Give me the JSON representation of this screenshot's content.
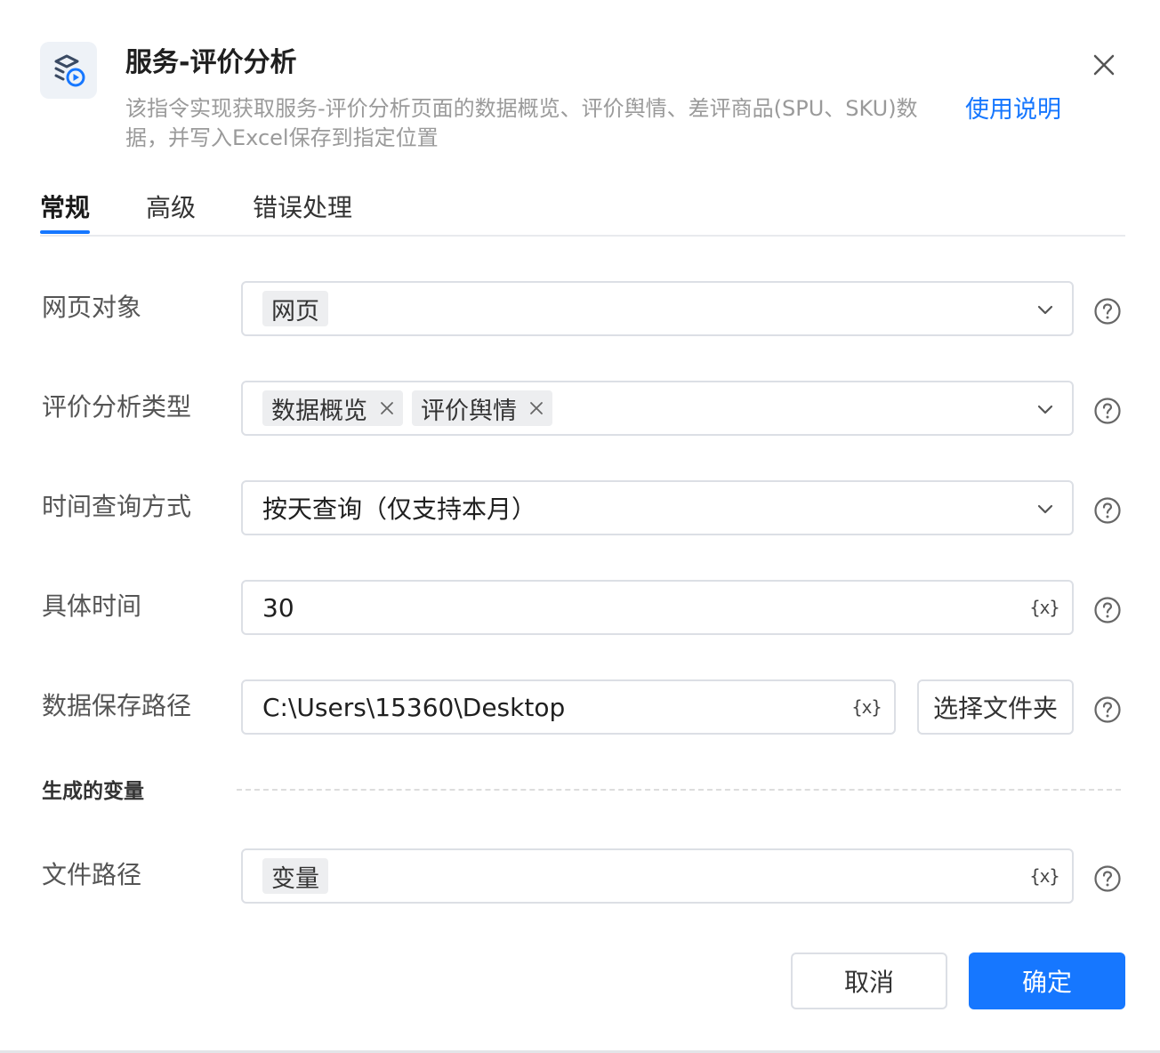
{
  "header": {
    "title": "服务-评价分析",
    "description": "该指令实现获取服务-评价分析页面的数据概览、评价舆情、差评商品(SPU、SKU)数据，并写入Excel保存到指定位置",
    "help_link": "使用说明",
    "icon": "service-analysis-icon"
  },
  "tabs": [
    {
      "label": "常规",
      "active": true
    },
    {
      "label": "高级",
      "active": false
    },
    {
      "label": "错误处理",
      "active": false
    }
  ],
  "form": {
    "webpage_object": {
      "label": "网页对象",
      "chip": "网页"
    },
    "analysis_type": {
      "label": "评价分析类型",
      "chips": [
        "数据概览",
        "评价舆情"
      ]
    },
    "time_query_mode": {
      "label": "时间查询方式",
      "value": "按天查询（仅支持本月）"
    },
    "specific_time": {
      "label": "具体时间",
      "value": "30"
    },
    "save_path": {
      "label": "数据保存路径",
      "value": "C:\\Users\\15360\\Desktop",
      "select_folder_label": "选择文件夹"
    }
  },
  "variables_section": {
    "title": "生成的变量",
    "file_path": {
      "label": "文件路径",
      "chip": "变量"
    }
  },
  "variable_button_label": "{x}",
  "footer": {
    "cancel_label": "取消",
    "ok_label": "确定"
  },
  "colors": {
    "accent": "#1677ff",
    "border": "#dcdfe5",
    "chip_bg": "#edeef0"
  }
}
